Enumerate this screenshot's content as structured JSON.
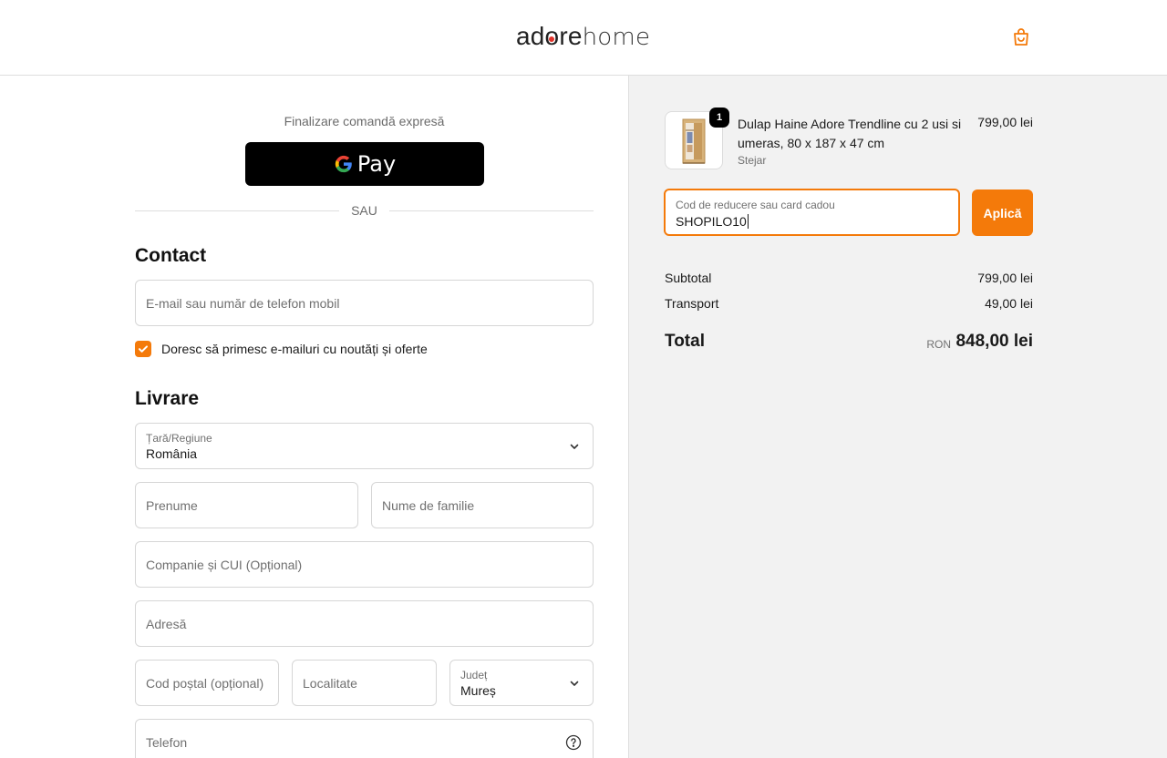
{
  "header": {
    "logo_part1": "adore",
    "logo_part2": "home",
    "colors": {
      "accent": "#f47a0a",
      "logo_dot": "#e2332b"
    },
    "cart_icon": "shopping-bag-icon"
  },
  "express": {
    "title": "Finalizare comandă expresă",
    "gpay_label": "Pay",
    "divider_text": "SAU"
  },
  "contact": {
    "title": "Contact",
    "email_placeholder": "E-mail sau număr de telefon mobil",
    "newsletter_label": "Doresc să primesc e-mailuri cu noutăți și oferte",
    "newsletter_checked": true
  },
  "delivery": {
    "title": "Livrare",
    "country_label": "Țară/Regiune",
    "country_value": "România",
    "first_name_placeholder": "Prenume",
    "last_name_placeholder": "Nume de familie",
    "company_placeholder": "Companie și CUI (Opțional)",
    "address_placeholder": "Adresă",
    "postal_placeholder": "Cod poștal (opțional)",
    "city_placeholder": "Localitate",
    "county_label": "Județ",
    "county_value": "Mureș",
    "phone_placeholder": "Telefon"
  },
  "summary": {
    "product": {
      "quantity": "1",
      "name": "Dulap Haine Adore Trendline cu 2 usi si umeras, 80 x 187 x 47 cm",
      "variant": "Stejar",
      "price": "799,00 lei"
    },
    "discount": {
      "label": "Cod de reducere sau card cadou",
      "value": "SHOPILO10",
      "apply_label": "Aplică"
    },
    "subtotal_label": "Subtotal",
    "subtotal_value": "799,00 lei",
    "shipping_label": "Transport",
    "shipping_value": "49,00 lei",
    "total_label": "Total",
    "total_currency": "RON",
    "total_value": "848,00 lei"
  }
}
